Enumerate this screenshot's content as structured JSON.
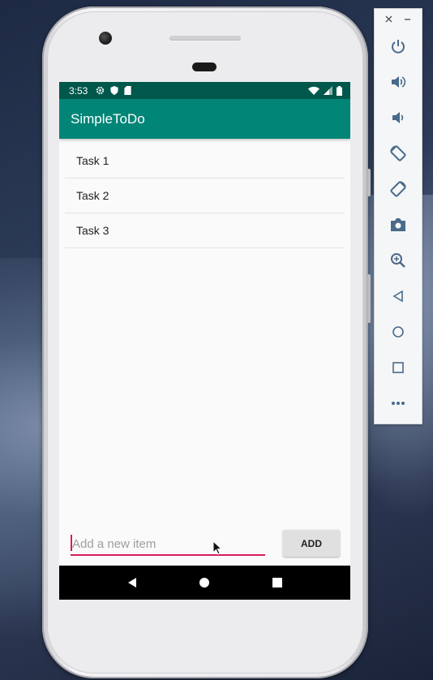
{
  "status_bar": {
    "time": "3:53",
    "icons": [
      "gear-icon",
      "shield-icon",
      "sdcard-icon",
      "wifi-icon",
      "signal-icon",
      "battery-icon"
    ]
  },
  "app_bar": {
    "title": "SimpleToDo"
  },
  "tasks": [
    "Task 1",
    "Task 2",
    "Task 3"
  ],
  "new_item": {
    "placeholder": "Add a new item",
    "value": ""
  },
  "add_button": {
    "label": "ADD"
  },
  "emulator_toolbar": {
    "window_controls": [
      "close-icon",
      "minimize-icon"
    ],
    "buttons": [
      "power-icon",
      "volume-up-icon",
      "volume-down-icon",
      "rotate-left-icon",
      "rotate-right-icon",
      "camera-icon",
      "zoom-icon",
      "back-icon",
      "home-icon",
      "overview-icon",
      "more-icon"
    ]
  },
  "colors": {
    "primary": "#008577",
    "primary_dark": "#00574b",
    "accent": "#d81b60"
  }
}
